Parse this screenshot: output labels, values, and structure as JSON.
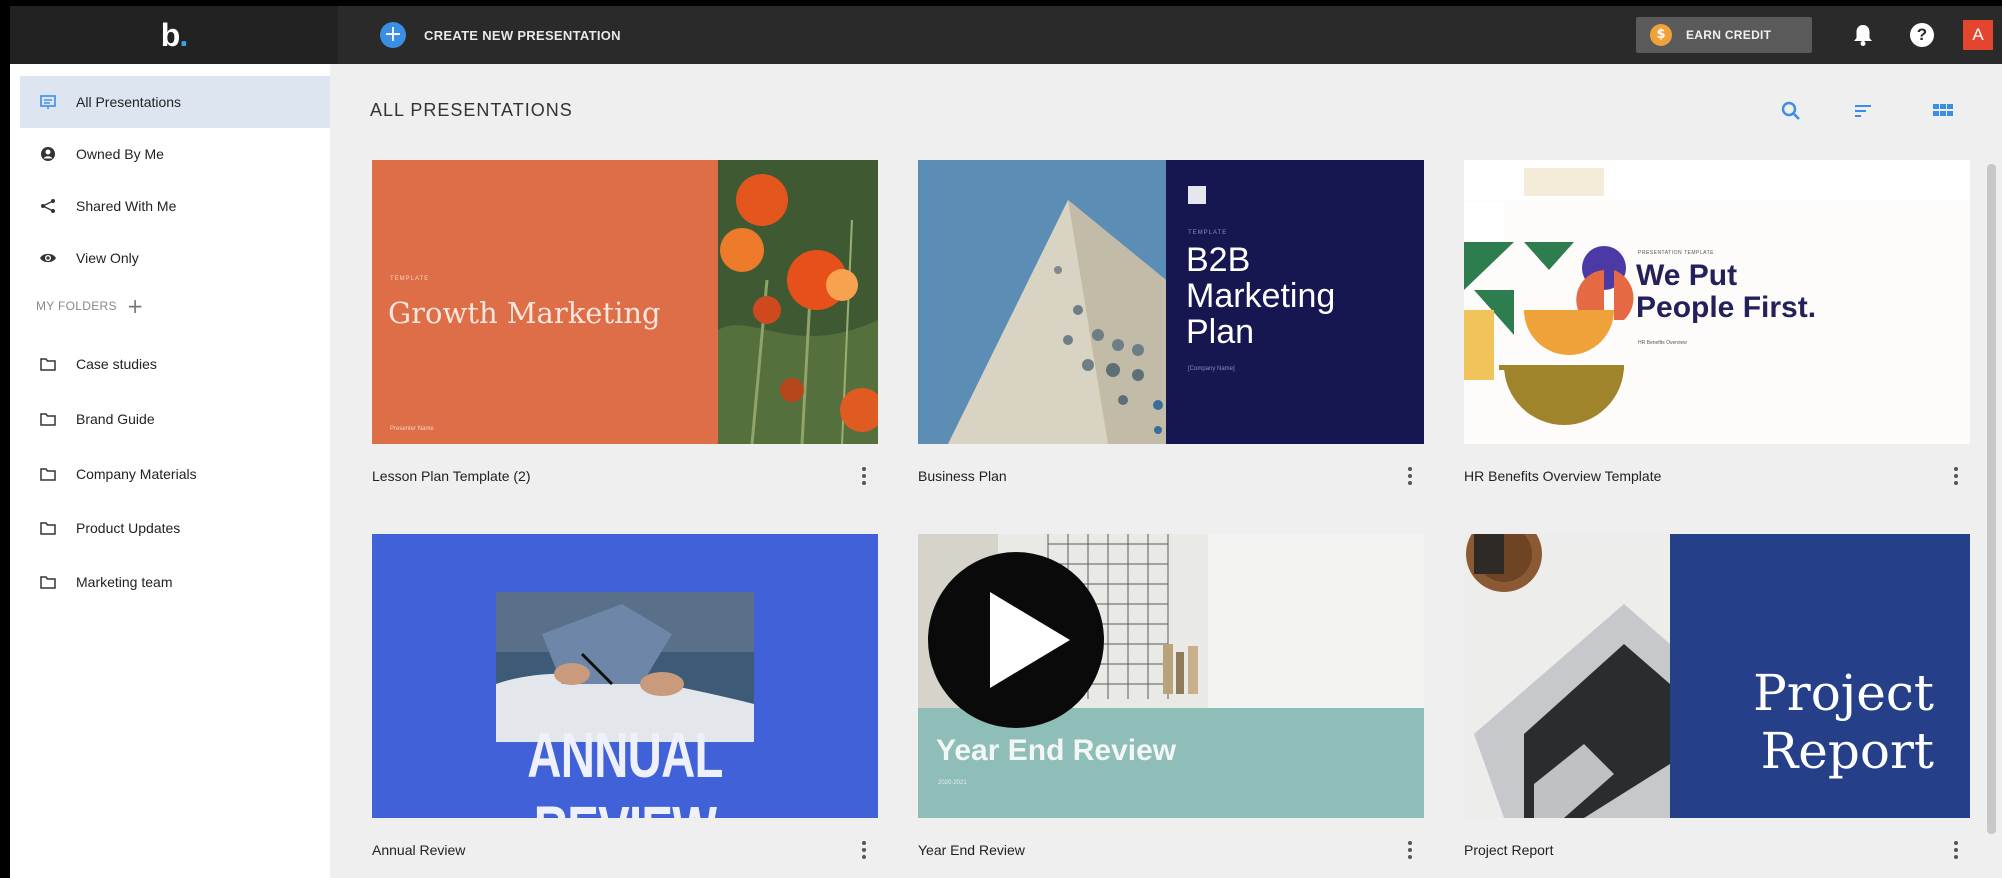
{
  "app": {
    "logo": "b",
    "logo_dot": "."
  },
  "topbar": {
    "create_label": "CREATE NEW PRESENTATION",
    "earn_credit_label": "EARN CREDIT",
    "coin_symbol": "$",
    "help_symbol": "?",
    "avatar_initial": "A"
  },
  "sidebar": {
    "items": [
      {
        "label": "All Presentations",
        "icon": "presentation-icon",
        "active": true
      },
      {
        "label": "Owned By Me",
        "icon": "user-circle-icon"
      },
      {
        "label": "Shared With Me",
        "icon": "share-icon"
      },
      {
        "label": "View Only",
        "icon": "eye-icon"
      }
    ],
    "folders_header": "MY FOLDERS",
    "folders_add": "+",
    "folders": [
      {
        "label": "Case studies",
        "icon": "folder-icon"
      },
      {
        "label": "Brand Guide",
        "icon": "folder-icon"
      },
      {
        "label": "Company Materials",
        "icon": "folder-icon"
      },
      {
        "label": "Product Updates",
        "icon": "folder-icon"
      },
      {
        "label": "Marketing team",
        "icon": "folder-icon"
      }
    ]
  },
  "main": {
    "title": "ALL PRESENTATIONS",
    "tools": [
      "search-icon",
      "sort-icon",
      "grid-view-icon"
    ],
    "accent": "#3a8ee6"
  },
  "presentations": [
    {
      "title": "Lesson Plan Template (2)",
      "slide_kicker": "TEMPLATE",
      "slide_title": "Growth Marketing",
      "slide_footer": "Presenter Name"
    },
    {
      "title": "Business Plan",
      "slide_kicker": "TEMPLATE",
      "slide_title_lines": [
        "B2B",
        "Marketing",
        "Plan"
      ],
      "slide_sub": "[Company Name]"
    },
    {
      "title": "HR Benefits Overview Template",
      "slide_kicker": "PRESENTATION TEMPLATE",
      "slide_title_lines": [
        "We Put",
        "People First."
      ],
      "slide_sub": "HR Benefits Overview"
    },
    {
      "title": "Annual Review",
      "slide_title": "ANNUAL REVIEW"
    },
    {
      "title": "Year End Review",
      "slide_title": "Year End Review",
      "slide_sub": "2020-2021"
    },
    {
      "title": "Project Report",
      "slide_title_lines": [
        "Project",
        "Report"
      ]
    }
  ]
}
